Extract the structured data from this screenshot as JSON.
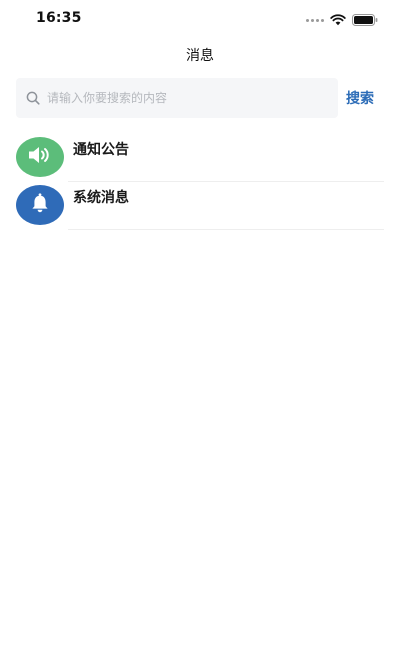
{
  "status_bar": {
    "time": "16:35"
  },
  "header": {
    "title": "消息"
  },
  "search": {
    "placeholder": "请输入你要搜索的内容",
    "value": "",
    "button_label": "搜索"
  },
  "messages": [
    {
      "label": "通知公告",
      "icon": "speaker-icon",
      "color": "#5cbd7a"
    },
    {
      "label": "系统消息",
      "icon": "bell-icon",
      "color": "#2f6bb8"
    }
  ],
  "colors": {
    "accent": "#2c6cb7"
  }
}
